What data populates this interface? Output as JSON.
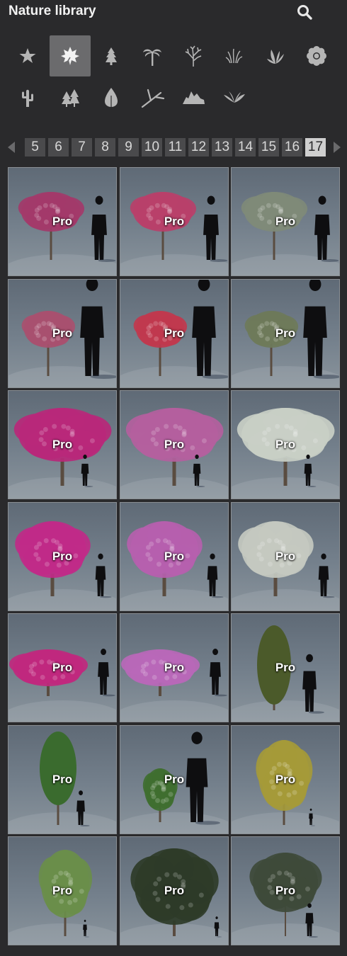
{
  "header": {
    "title": "Nature library",
    "search_icon": "search-icon"
  },
  "categories": [
    {
      "icon": "star-icon",
      "active": false
    },
    {
      "icon": "leaf-icon",
      "active": true
    },
    {
      "icon": "conifer-icon",
      "active": false
    },
    {
      "icon": "palm-icon",
      "active": false
    },
    {
      "icon": "bare-tree-icon",
      "active": false
    },
    {
      "icon": "grass-icon",
      "active": false
    },
    {
      "icon": "plant-icon",
      "active": false
    },
    {
      "icon": "flower-icon",
      "active": false
    },
    {
      "icon": "cactus-icon",
      "active": false
    },
    {
      "icon": "forest-icon",
      "active": false
    },
    {
      "icon": "leaf-drop-icon",
      "active": false
    },
    {
      "icon": "branch-icon",
      "active": false
    },
    {
      "icon": "rock-icon",
      "active": false
    },
    {
      "icon": "fern-icon",
      "active": false
    }
  ],
  "pager": {
    "prev_icon": "chevron-left-icon",
    "next_icon": "chevron-right-icon",
    "pages": [
      "5",
      "6",
      "7",
      "8",
      "9",
      "10",
      "11",
      "12",
      "13",
      "14",
      "15",
      "16",
      "17"
    ],
    "current": "17"
  },
  "items": [
    {
      "badge": "Pro",
      "foliage": "#a33a6a",
      "type": "shrub-tall"
    },
    {
      "badge": "Pro",
      "foliage": "#b8406a",
      "type": "shrub-tall"
    },
    {
      "badge": "Pro",
      "foliage": "#7f8a78",
      "type": "shrub-tall"
    },
    {
      "badge": "Pro",
      "foliage": "#a8506f",
      "type": "small-tree-big-person"
    },
    {
      "badge": "Pro",
      "foliage": "#c0384e",
      "type": "small-tree-big-person"
    },
    {
      "badge": "Pro",
      "foliage": "#6e7a5a",
      "type": "small-tree-big-person"
    },
    {
      "badge": "Pro",
      "foliage": "#b8287a",
      "type": "wide-bloom"
    },
    {
      "badge": "Pro",
      "foliage": "#b4609e",
      "type": "wide-bloom"
    },
    {
      "badge": "Pro",
      "foliage": "#c9cfc6",
      "type": "wide-bloom"
    },
    {
      "badge": "Pro",
      "foliage": "#c02a88",
      "type": "round-bloom"
    },
    {
      "badge": "Pro",
      "foliage": "#b65fae",
      "type": "round-bloom"
    },
    {
      "badge": "Pro",
      "foliage": "#c4c9c0",
      "type": "round-bloom"
    },
    {
      "badge": "Pro",
      "foliage": "#c0287e",
      "type": "low-bloom"
    },
    {
      "badge": "Pro",
      "foliage": "#b968b8",
      "type": "low-bloom"
    },
    {
      "badge": "Pro",
      "foliage": "#4b5a2a",
      "type": "columnar"
    },
    {
      "badge": "Pro",
      "foliage": "#3a6b2e",
      "type": "young-tree"
    },
    {
      "badge": "Pro",
      "foliage": "#3f6e30",
      "type": "young-tree-big-person"
    },
    {
      "badge": "Pro",
      "foliage": "#a59a38",
      "type": "yellow-tree"
    },
    {
      "badge": "Pro",
      "foliage": "#6a8e4a",
      "type": "leafy-tree"
    },
    {
      "badge": "Pro",
      "foliage": "#2e3b28",
      "type": "dense-tree"
    },
    {
      "badge": "Pro",
      "foliage": "#3e4a3a",
      "type": "open-tree"
    }
  ]
}
